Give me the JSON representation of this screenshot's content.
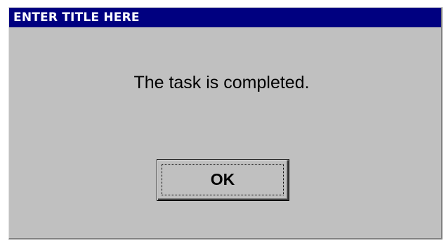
{
  "dialog": {
    "title": "ENTER TITLE HERE",
    "message": "The task is completed.",
    "ok_label": "OK"
  },
  "colors": {
    "titlebar": "#000080",
    "dialog_background": "#c0c0c0",
    "title_text": "#ffffff"
  }
}
